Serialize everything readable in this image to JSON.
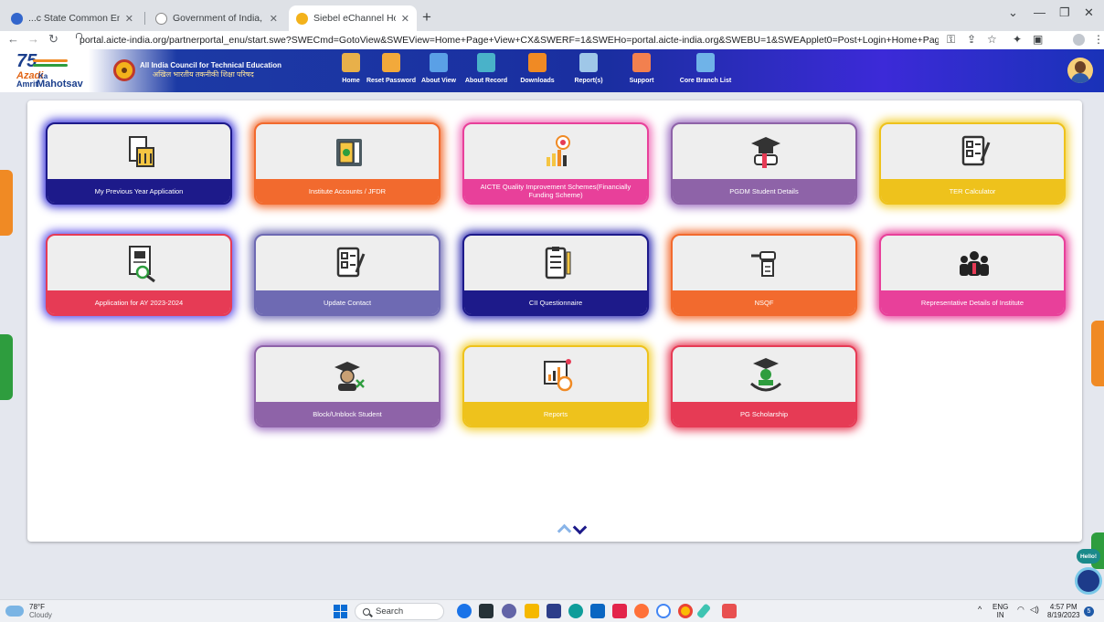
{
  "browser": {
    "tabs": [
      {
        "label": "...c State Common Entrance Test I",
        "active": false
      },
      {
        "label": "Government of India, All India Co",
        "active": false
      },
      {
        "label": "Siebel eChannel Home",
        "active": true
      }
    ],
    "new_tab": "+",
    "url": "portal.aicte-india.org/partnerportal_enu/start.swe?SWECmd=GotoView&SWEView=Home+Page+View+CX&SWERF=1&SWEHo=portal.aicte-india.org&SWEBU=1&SWEApplet0=Post+Login+Home+Page+Navigation+Links+Applet+CXPRM&SWER..."
  },
  "header": {
    "logo_text": {
      "num": "75",
      "w1": "Azadi",
      "w2": "Ka",
      "w3": "Amrit",
      "w4": "Mahotsav"
    },
    "org_name_en": "All India Council for Technical Education",
    "org_name_hi": "अखिल भारतीय तकनीकी शिक्षा परिषद",
    "nav": [
      {
        "label": "Home",
        "icon": "home-icon",
        "color": "#e8b04a"
      },
      {
        "label": "Reset Password",
        "icon": "reset-password-icon",
        "color": "#f2a93b"
      },
      {
        "label": "About View",
        "icon": "about-view-icon",
        "color": "#5aa0e6"
      },
      {
        "label": "About Record",
        "icon": "about-record-icon",
        "color": "#49b2c9"
      },
      {
        "label": "Downloads",
        "icon": "downloads-icon",
        "color": "#f08a24"
      },
      {
        "label": "Report(s)",
        "icon": "reports-icon",
        "color": "#9fc7e8"
      },
      {
        "label": "Support",
        "icon": "support-icon",
        "color": "#f2804f"
      },
      {
        "label": "Core Branch List",
        "icon": "core-branch-list-icon",
        "color": "#6fb3e8"
      }
    ]
  },
  "cards": [
    {
      "label": "My Previous Year Application",
      "icon": "institution-document-icon",
      "color": "#1d1a8a",
      "glow": "#3a34d8"
    },
    {
      "label": "Institute Accounts / JFDR",
      "icon": "accounts-ledger-icon",
      "color": "#f26a2e",
      "glow": "#f26a2e"
    },
    {
      "label": "AICTE Quality Improvement Schemes(Financially Funding Scheme)",
      "icon": "quality-improvement-icon",
      "color": "#e8409a",
      "glow": "#f070b8"
    },
    {
      "label": "PGDM Student Details",
      "icon": "graduation-cap-icon",
      "color": "#8e63a8",
      "glow": "#9b6cc0"
    },
    {
      "label": "TER Calculator",
      "icon": "checklist-icon",
      "color": "#eec21c",
      "glow": "#f3cf34"
    },
    {
      "label": "Application for AY 2023-2024",
      "icon": "approved-application-icon",
      "color": "#e63b55",
      "glow": "#5b4de6"
    },
    {
      "label": "Update Contact",
      "icon": "checklist-icon",
      "color": "#6e6ab3",
      "glow": "#6e6ab3"
    },
    {
      "label": "CII Questionnaire",
      "icon": "questionnaire-icon",
      "color": "#1d1a8a",
      "glow": "#2b28b0"
    },
    {
      "label": "NSQF",
      "icon": "skill-hand-icon",
      "color": "#f26a2e",
      "glow": "#f26a2e"
    },
    {
      "label": "Representative Details of Institute",
      "icon": "group-people-icon",
      "color": "#e8409a",
      "glow": "#e8409a"
    },
    {
      "label": "Block/Unblock Student",
      "icon": "block-student-icon",
      "color": "#8e63a8",
      "glow": "#9b6cc0"
    },
    {
      "label": "Reports",
      "icon": "report-chart-icon",
      "color": "#eec21c",
      "glow": "#f3cf34"
    },
    {
      "label": "PG Scholarship",
      "icon": "scholarship-icon",
      "color": "#e63b55",
      "glow": "#e63b55"
    }
  ],
  "chatbot": {
    "label": "Hello!"
  },
  "taskbar": {
    "weather_temp": "78°F",
    "weather_cond": "Cloudy",
    "search_label": "Search",
    "lang_1": "ENG",
    "lang_2": "IN",
    "time": "4:57 PM",
    "date": "8/19/2023",
    "notif_count": "5"
  }
}
